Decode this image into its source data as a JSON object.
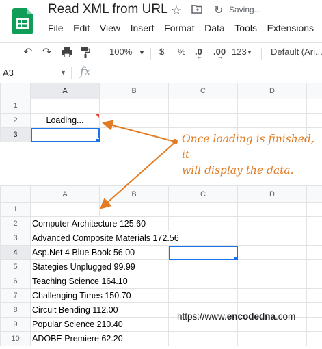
{
  "doc": {
    "title": "Read XML from URL",
    "status": "Saving..."
  },
  "menu": [
    "File",
    "Edit",
    "View",
    "Insert",
    "Format",
    "Data",
    "Tools",
    "Extensions"
  ],
  "toolbar": {
    "zoom": "100%",
    "currency": "$",
    "percent": "%",
    "dec_decrease": ".0",
    "dec_increase": ".00",
    "more_formats": "123",
    "font": "Default (Ari..."
  },
  "formula_bar": {
    "cell_ref": "A3",
    "fx": "fx"
  },
  "columns": [
    "A",
    "B",
    "C",
    "D"
  ],
  "top_grid": {
    "row_numbers": [
      "1",
      "2",
      "3"
    ],
    "loading_text": "Loading..."
  },
  "bottom_grid": {
    "row_numbers": [
      "1",
      "2",
      "3",
      "4",
      "5",
      "6",
      "7",
      "8",
      "9",
      "10"
    ],
    "rows": [
      "",
      "Computer Architecture 125.60",
      "Advanced Composite Materials 172.56",
      "Asp.Net 4 Blue Book 56.00",
      "Stategies Unplugged 99.99",
      "Teaching Science 164.10",
      "Challenging Times 150.70",
      "Circuit Bending 112.00",
      "Popular Science 210.40",
      "ADOBE Premiere 62.20"
    ]
  },
  "annotation": {
    "line1": "Once loading is finished, it",
    "line2": "will display the data."
  },
  "credit": {
    "prefix": "https://www.",
    "brand": "encodedna",
    "suffix": ".com"
  },
  "colors": {
    "accent": "#1a73e8",
    "annotation": "#e37b22",
    "sheets_green": "#0f9d58"
  }
}
